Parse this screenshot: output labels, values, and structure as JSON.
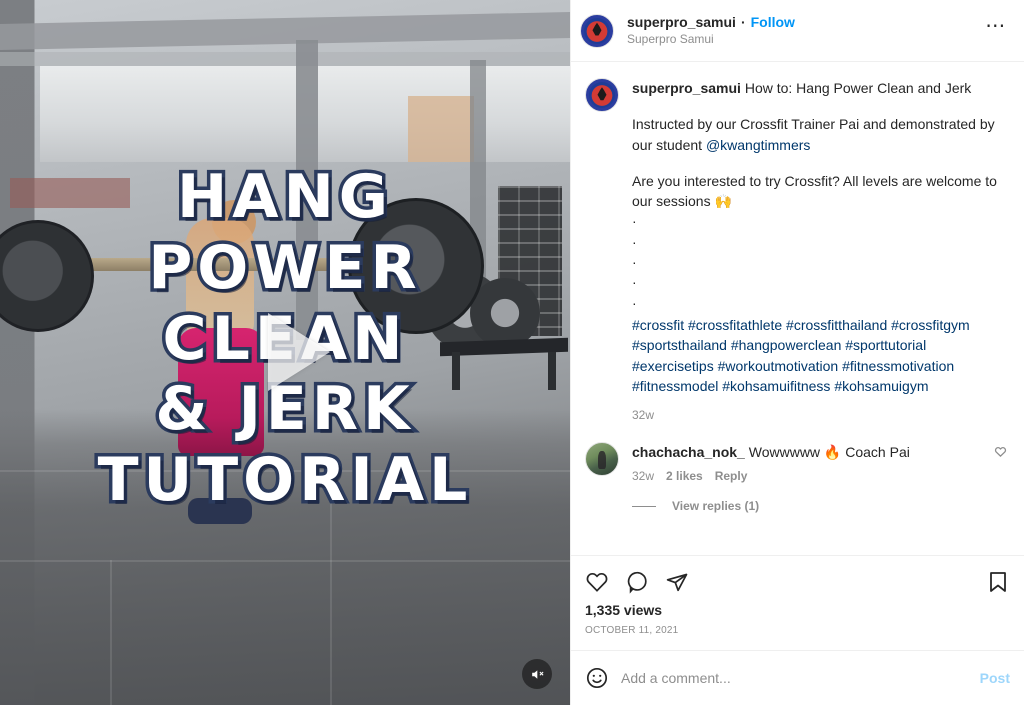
{
  "header": {
    "username": "superpro_samui",
    "separator": "·",
    "follow_label": "Follow",
    "subtitle": "Superpro Samui",
    "more_label": "⋯",
    "avatar_icon": "brand-logo-avatar"
  },
  "media": {
    "overlay_lines": [
      "HANG",
      "POWER",
      "CLEAN",
      "& JERK",
      "TUTORIAL"
    ],
    "play_icon": "play-icon",
    "mute_icon": "mute-icon"
  },
  "caption": {
    "username": "superpro_samui",
    "line1": "How to: Hang Power Clean and Jerk",
    "para2_prefix": "Instructed by our Crossfit Trainer Pai and demonstrated by our student ",
    "para2_mention": "@kwangtimmers",
    "para3": "Are you interested to try Crossfit? All levels are welcome to our sessions 🙌",
    "bullets": [
      "·",
      "·",
      "·",
      "·",
      "·"
    ],
    "hashtags": "#crossfit #crossfitathlete #crossfitthailand #crossfitgym #sportsthailand #hangpowerclean #sporttutorial #exercisetips #workoutmotivation #fitnessmotivation #fitnessmodel #kohsamuifitness #kohsamuigym",
    "time_ago": "32w"
  },
  "comments": [
    {
      "username": "chachacha_nok_",
      "text": "Wowwwww 🔥 Coach Pai",
      "time_ago": "32w",
      "likes": "2 likes",
      "reply_label": "Reply",
      "like_icon": "heart-icon",
      "avatar_icon": "user-photo-avatar"
    }
  ],
  "view_replies": {
    "label": "View replies (1)"
  },
  "actions": {
    "like_icon": "heart-icon",
    "comment_icon": "comment-bubble-icon",
    "share_icon": "share-paperplane-icon",
    "save_icon": "bookmark-icon",
    "views": "1,335 views",
    "date": "OCTOBER 11, 2021"
  },
  "add_comment": {
    "emoji_icon": "emoji-smiley-icon",
    "placeholder": "Add a comment...",
    "value": "",
    "post_label": "Post"
  },
  "colors": {
    "link_blue": "#0095f6",
    "tag_blue": "#00376b",
    "primary_text": "#262626",
    "secondary_text": "#8e8e8e",
    "border": "#efefef"
  }
}
